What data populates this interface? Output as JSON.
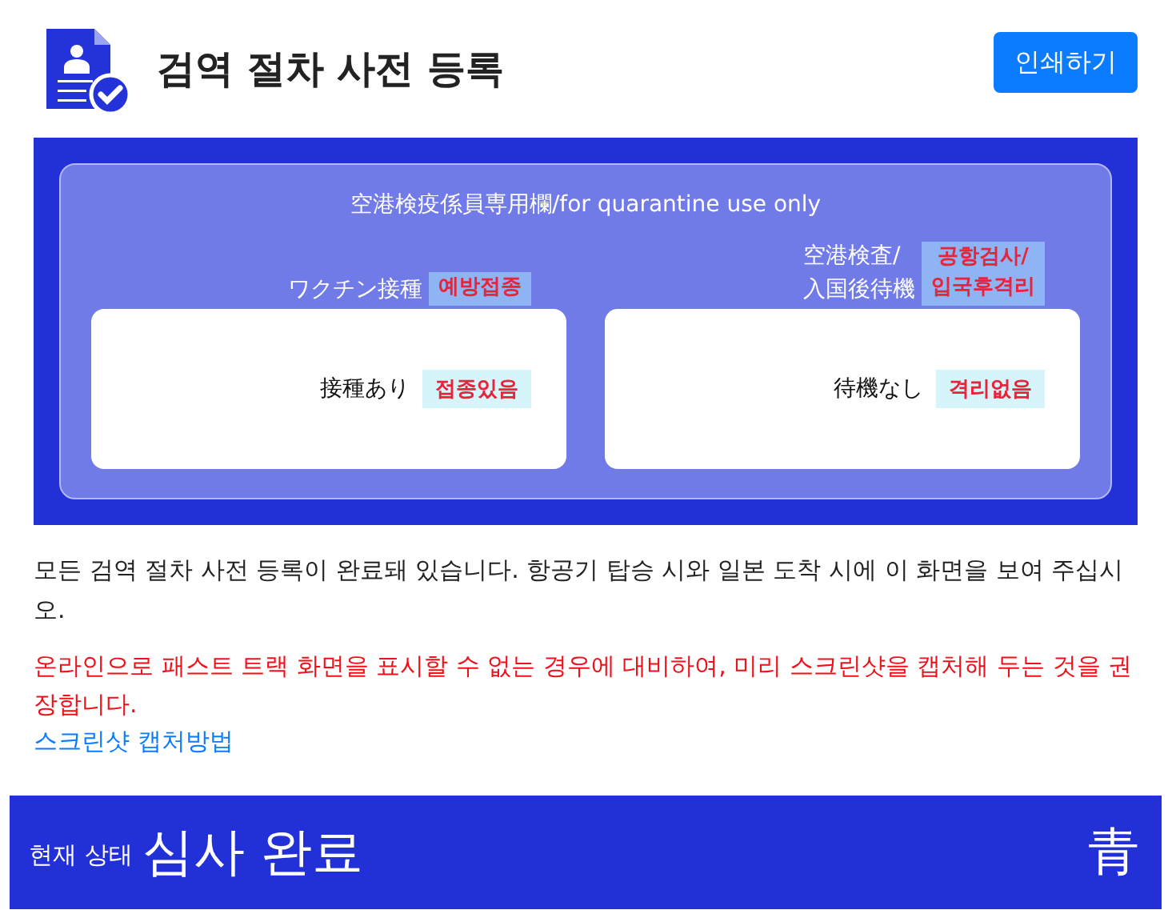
{
  "header": {
    "title": "검역 절차 사전 등록",
    "print_button": "인쇄하기"
  },
  "quarantine_panel": {
    "heading": "空港検疫係員専用欄/for quarantine use only",
    "sections": [
      {
        "label": "ワクチン接種",
        "label_tag": "예방접종",
        "value": "接種あり",
        "value_tag": "접종있음"
      },
      {
        "label": "空港検査/\n入国後待機",
        "label_tag": "공항검사/\n입국후격리",
        "value": "待機なし",
        "value_tag": "격리없음"
      }
    ]
  },
  "notice": "모든 검역 절차 사전 등록이 완료돼 있습니다. 항공기 탑승 시와 일본 도착 시에 이 화면을 보여 주십시오.",
  "warning": "온라인으로 패스트 트랙 화면을 표시할 수 없는 경우에 대비하여, 미리 스크린샷을 캡처해 두는 것을 권장합니다.",
  "link": "스크린샷 캡처방법",
  "status_bar": {
    "caption": "현재 상태",
    "status": "심사 완료",
    "badge": "青"
  }
}
